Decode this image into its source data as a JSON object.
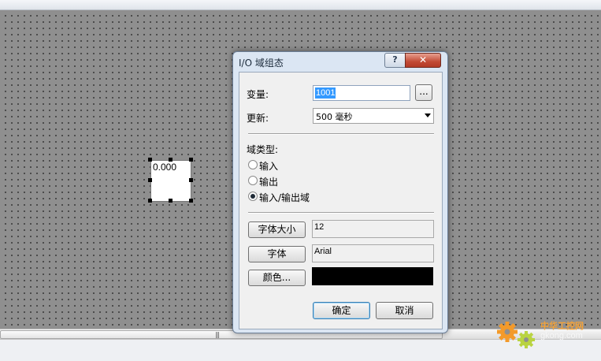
{
  "canvas": {
    "io_field_value": "0.000"
  },
  "dialog": {
    "title": "I/O 域组态",
    "help_glyph": "?",
    "close_glyph": "✕",
    "variable": {
      "label": "变量:",
      "value": "1001",
      "browse_label": "..."
    },
    "update": {
      "label": "更新:",
      "value": "500 毫秒"
    },
    "field_type": {
      "label": "域类型:",
      "options": [
        {
          "label": "输入",
          "selected": false
        },
        {
          "label": "输出",
          "selected": false
        },
        {
          "label": "输入/输出域",
          "selected": true
        }
      ]
    },
    "font_size": {
      "button_label": "字体大小",
      "value": "12"
    },
    "font": {
      "button_label": "字体",
      "value": "Arial"
    },
    "color": {
      "button_label": "颜色...",
      "value_color": "#000000"
    },
    "ok_label": "确定",
    "cancel_label": "取消"
  },
  "scrollbar": {
    "grip": "|||"
  },
  "watermark": {
    "cn": "中华工控网",
    "en": "gkong.com"
  }
}
